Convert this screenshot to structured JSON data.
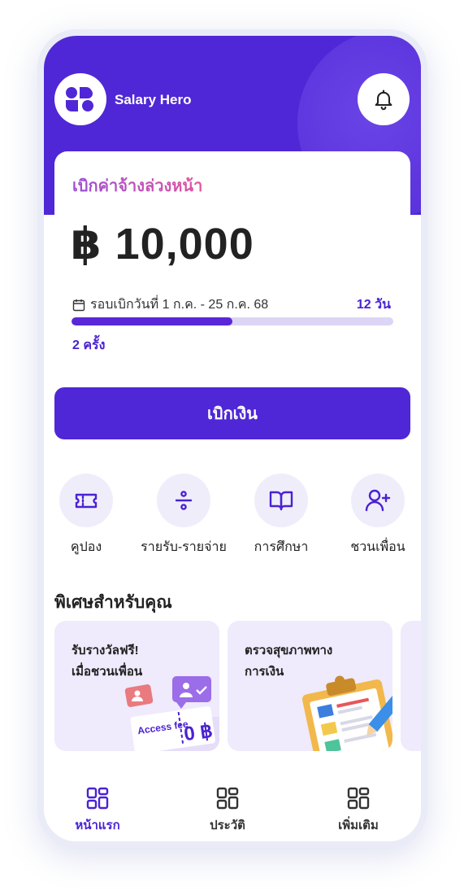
{
  "header": {
    "brand_name": "Salary Hero",
    "logo_icon": "salary-hero-logo-icon",
    "bell_icon": "bell-icon"
  },
  "advance_card": {
    "title": "เบิกค่าจ้างล่วงหน้า",
    "amount": "฿ 10,000",
    "period_icon": "calendar-icon",
    "period_label": "รอบเบิกวันที่ 1 ก.ค. - 25 ก.ค. 68",
    "days_remaining": "12 วัน",
    "withdraw_count": "2 ครั้ง",
    "progress_fraction": 0.5
  },
  "withdraw_button": {
    "label": "เบิกเงิน"
  },
  "quick_actions": [
    {
      "label": "คูปอง",
      "icon": "coupon-icon"
    },
    {
      "label": "รายรับ-รายจ่าย",
      "icon": "divide-icon"
    },
    {
      "label": "การศึกษา",
      "icon": "book-icon"
    },
    {
      "label": "ชวนเพื่อน",
      "icon": "add-user-icon"
    }
  ],
  "promotions": {
    "title": "พิเศษสำหรับคุณ",
    "cards": [
      {
        "line1": "รับรางวัลฟรี!",
        "line2": "เมื่อชวนเพื่อน",
        "ticket_text": "Access fee",
        "ticket_amount": "0 ฿"
      },
      {
        "line1": "ตรวจสุขภาพทาง",
        "line2": "การเงิน"
      }
    ]
  },
  "bottom_nav": [
    {
      "label": "หน้าแรก",
      "icon": "home-grid-icon",
      "active": true
    },
    {
      "label": "ประวัติ",
      "icon": "history-grid-icon",
      "active": false
    },
    {
      "label": "เพิ่มเติม",
      "icon": "more-grid-icon",
      "active": false
    }
  ],
  "colors": {
    "primary": "#4f27d6",
    "progress_track": "#dcd5f5",
    "promo_bg": "#efeafc",
    "title_gradient_start": "#9b4fd6",
    "title_gradient_end": "#e0569f"
  }
}
